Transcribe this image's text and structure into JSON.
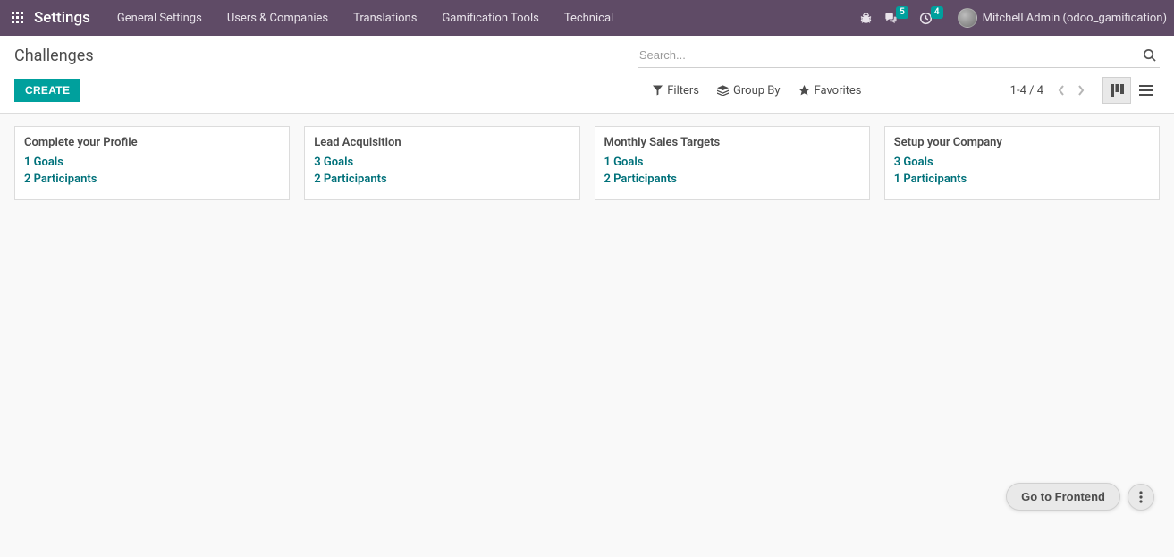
{
  "topbar": {
    "brand": "Settings",
    "nav": [
      "General Settings",
      "Users & Companies",
      "Translations",
      "Gamification Tools",
      "Technical"
    ],
    "messages_badge": "5",
    "activities_badge": "4",
    "user": "Mitchell Admin (odoo_gamification)"
  },
  "cp": {
    "title": "Challenges",
    "create": "CREATE",
    "search_placeholder": "Search...",
    "filters": "Filters",
    "groupby": "Group By",
    "favorites": "Favorites",
    "pager": "1-4 / 4"
  },
  "cards": [
    {
      "title": "Complete your Profile",
      "goals": "1 Goals",
      "participants": "2 Participants"
    },
    {
      "title": "Lead Acquisition",
      "goals": "3 Goals",
      "participants": "2 Participants"
    },
    {
      "title": "Monthly Sales Targets",
      "goals": "1 Goals",
      "participants": "2 Participants"
    },
    {
      "title": "Setup your Company",
      "goals": "3 Goals",
      "participants": "1 Participants"
    }
  ],
  "floating": {
    "label": "Go to Frontend"
  }
}
